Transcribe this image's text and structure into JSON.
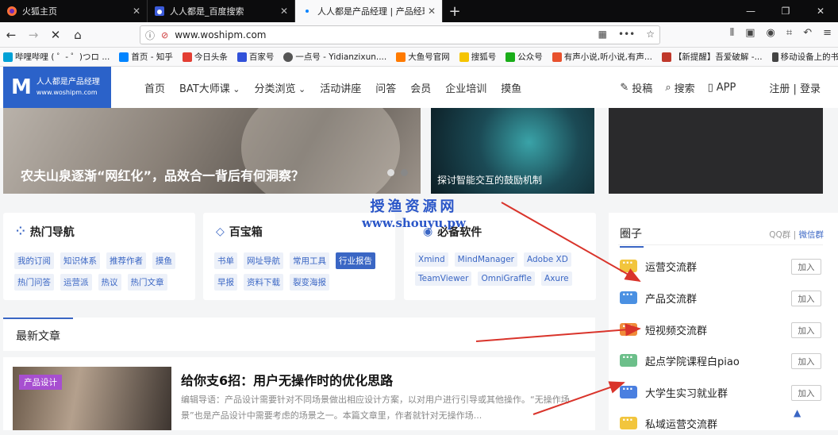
{
  "browser": {
    "tabs": [
      {
        "title": "火狐主页",
        "active": false
      },
      {
        "title": "人人都是_百度搜索",
        "active": false
      },
      {
        "title": "人人都是产品经理 | 产品经理、",
        "active": true
      }
    ],
    "url": "www.woshipm.com",
    "bookmarks": [
      {
        "label": "哔哩哔哩 ( ゜- ゜)つロ ...",
        "color": "#00a1d6"
      },
      {
        "label": "首页 - 知乎",
        "color": "#0084ff"
      },
      {
        "label": "今日头条",
        "color": "#e33e33"
      },
      {
        "label": "百家号",
        "color": "#3151d9"
      },
      {
        "label": "一点号 - Yidianzixun....",
        "color": "#555555"
      },
      {
        "label": "大鱼号官网",
        "color": "#ff7a00"
      },
      {
        "label": "搜狐号",
        "color": "#f5c400"
      },
      {
        "label": "公众号",
        "color": "#1aad19"
      },
      {
        "label": "有声小说,听小说,有声...",
        "color": "#e8512d"
      },
      {
        "label": "【新提醒】吾爱破解 -...",
        "color": "#c0392b"
      },
      {
        "label": "移动设备上的书签",
        "color": "#444444"
      }
    ]
  },
  "site": {
    "logo_title": "人人都是产品经理",
    "logo_sub": "www.woshipm.com",
    "nav": [
      "首页",
      "BAT大师课",
      "分类浏览",
      "活动讲座",
      "问答",
      "会员",
      "企业培训",
      "摸鱼"
    ],
    "header_right": {
      "post": "投稿",
      "search": "搜索",
      "app": "APP",
      "auth": "注册 | 登录"
    }
  },
  "banners": {
    "main_caption": "农夫山泉逐渐“网红化”，品效合一背后有何洞察？",
    "side_caption": "探讨智能交互的鼓励机制"
  },
  "cards": {
    "hot_nav": {
      "title": "热门导航",
      "tags": [
        "我的订阅",
        "知识体系",
        "推荐作者",
        "摸鱼",
        "热门问答",
        "运营派",
        "热议",
        "热门文章"
      ]
    },
    "toolbox": {
      "title": "百宝箱",
      "tags": [
        "书单",
        "网址导航",
        "常用工具",
        "行业报告",
        "早报",
        "资料下载",
        "裂变海报"
      ],
      "selected": "行业报告"
    },
    "software": {
      "title": "必备软件",
      "tags": [
        "Xmind",
        "MindManager",
        "Adobe XD",
        "TeamViewer",
        "OmniGraffle",
        "Axure"
      ]
    }
  },
  "watermark": {
    "line1": "授渔资源网",
    "line2": "www.shouyu.pw"
  },
  "latest": {
    "heading": "最新文章",
    "article": {
      "tag": "产品设计",
      "title": "给你支6招：用户无操作时的优化思路",
      "desc": "编辑导语：产品设计需要针对不同场景做出相应设计方案，以对用户进行引导或其他操作。“无操作场景”也是产品设计中需要考虑的场景之一。本篇文章里，作者就针对无操作场..."
    }
  },
  "circle": {
    "heading": "圈子",
    "links": {
      "qq": "QQ群",
      "sep": " | ",
      "wechat": "微信群"
    },
    "join_label": "加入",
    "groups": [
      {
        "name": "运营交流群",
        "color": "#f2c53d"
      },
      {
        "name": "产品交流群",
        "color": "#4a90e2"
      },
      {
        "name": "短视频交流群",
        "color": "#f08c3a"
      },
      {
        "name": "起点学院课程白piao",
        "color": "#6cbf8a"
      },
      {
        "name": "大学生实习就业群",
        "color": "#4a7fe0"
      },
      {
        "name": "私域运营交流群",
        "color": "#f2c53d"
      }
    ]
  },
  "colors": {
    "accent": "#3a66c4",
    "arrow": "#d9342b"
  }
}
